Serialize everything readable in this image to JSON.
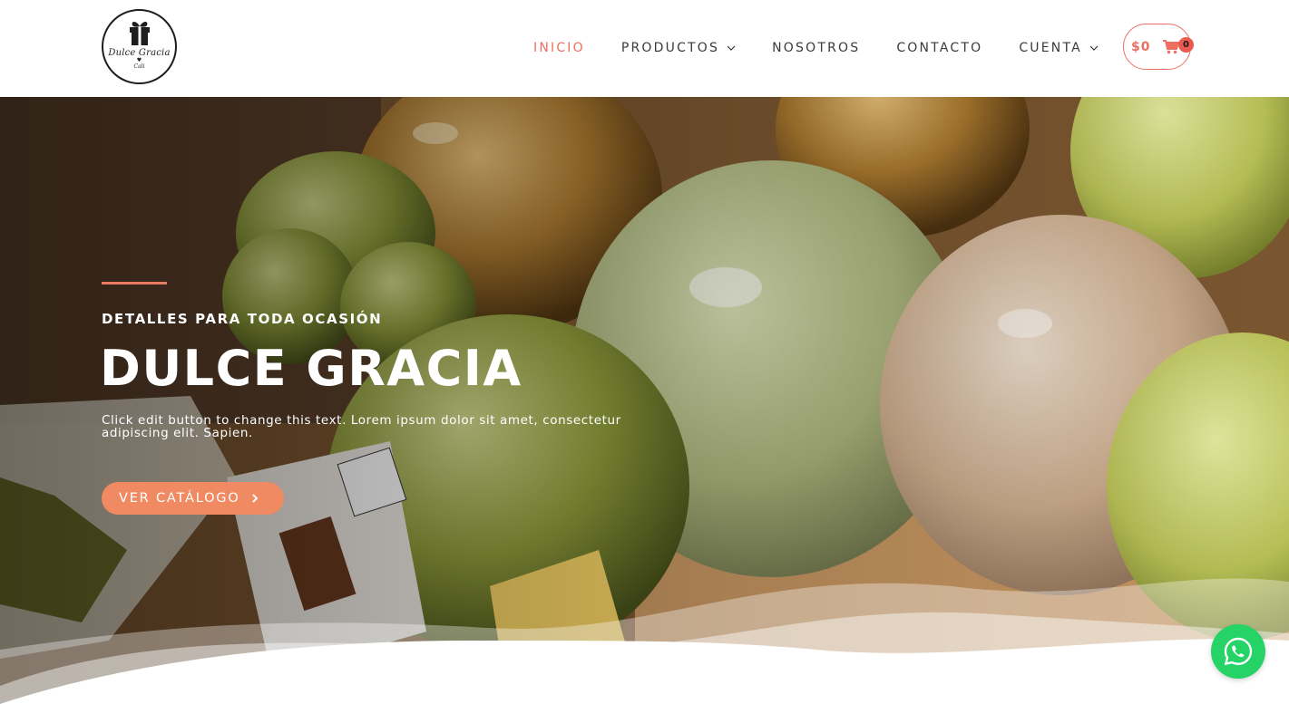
{
  "brand": {
    "logo_name": "Dulce Gracia",
    "logo_city": "Cali"
  },
  "nav": {
    "items": [
      {
        "label": "INICIO",
        "active": true,
        "dropdown": false
      },
      {
        "label": "PRODUCTOS",
        "active": false,
        "dropdown": true
      },
      {
        "label": "NOSOTROS",
        "active": false,
        "dropdown": false
      },
      {
        "label": "CONTACTO",
        "active": false,
        "dropdown": false
      },
      {
        "label": "CUENTA",
        "active": false,
        "dropdown": true
      }
    ]
  },
  "cart": {
    "total": "$0",
    "count": "0",
    "icon": "shopping-cart-icon"
  },
  "hero": {
    "kicker": "DETALLES PARA TODA OCASIÓN",
    "title": "DULCE GRACIA",
    "text": "Click edit button to change this text. Lorem ipsum dolor sit amet, consectetur adipiscing elit. Sapien.",
    "cta_label": "VER CATÁLOGO",
    "cta_icon": "chevron-right-icon"
  },
  "floating": {
    "whatsapp_icon": "whatsapp-icon"
  },
  "colors": {
    "accent": "#ec6f62",
    "cta": "#f08a62",
    "whatsapp": "#25d366",
    "nav_text": "#3a3a3a"
  }
}
